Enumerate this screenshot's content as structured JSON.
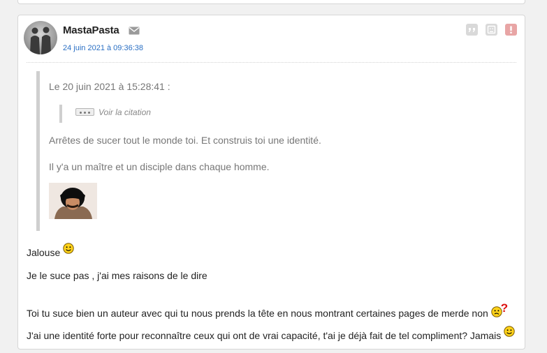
{
  "post": {
    "author": "MastaPasta",
    "date": "24 juin 2021 à 09:36:38",
    "icons": {
      "avatar": "avatar-silhouettes",
      "mail": "mail-icon",
      "quote": "quote-icon",
      "report": "sad-face-icon",
      "alert": "alert-icon"
    },
    "quote": {
      "meta": "Le 20 juin 2021 à 15:28:41 :",
      "see_quote": "Voir la citation",
      "lines": [
        "Arrêtes de sucer tout le monde toi. Et construis toi une identité.",
        "Il y'a un maître et un disciple dans chaque homme."
      ]
    },
    "body": [
      "Jalouse",
      "Je le suce pas , j'ai mes raisons de le dire",
      "Toi tu suce bien un auteur avec qui tu nous prends la tête en nous montrant certaines pages de merde non",
      "J'ai une identité forte pour reconnaître ceux qui ont de vrai capacité, t'ai je déjà fait de tel compliment? Jamais"
    ],
    "colors": {
      "date_link": "#2a6fc4",
      "alert": "#e8a5a5",
      "smiley": "#ffd21a"
    }
  }
}
